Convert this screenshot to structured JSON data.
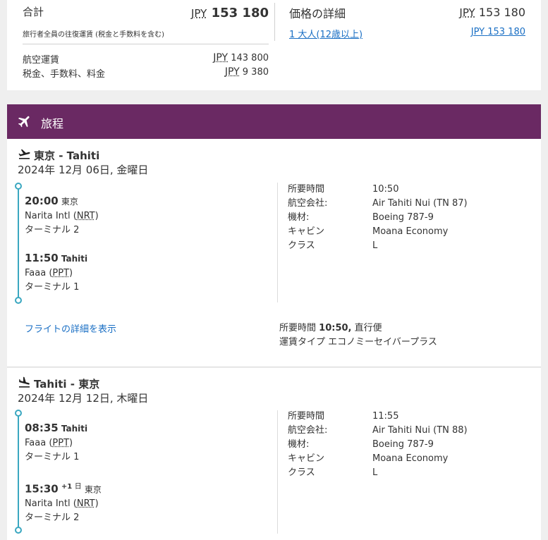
{
  "price_summary": {
    "total_label": "合計",
    "currency": "JPY",
    "total_amount": "153 180",
    "total_note": "旅行者全員の往復運賃 (税金と手数料を含む)",
    "fare_label": "航空運賃",
    "fare_amount": "143 800",
    "tax_label": "税金、手数料、料金",
    "tax_amount": "9 380"
  },
  "price_detail": {
    "title": "価格の詳細",
    "total_amount": "153 180",
    "passenger_link": "1 大人(12歳以上)",
    "passenger_amount": "153 180"
  },
  "itinerary": {
    "title": "旅程",
    "accent_color": "#6a2963",
    "timeline_color": "#3aa7c0",
    "link_color": "#1a6fc4"
  },
  "segments": [
    {
      "icon": "plane-departure-icon",
      "route": "東京 - Tahiti",
      "date": "2024年 12月 06日, 金曜日",
      "departure": {
        "time": "20:00",
        "day_offset": "",
        "day_unit": "",
        "city": "東京",
        "airport": "Narita Intl",
        "code": "NRT",
        "terminal": "ターミナル 2"
      },
      "arrival": {
        "time": "11:50",
        "day_offset": "",
        "day_unit": "",
        "city": "Tahiti",
        "airport": "Faaa",
        "code": "PPT",
        "terminal": "ターミナル 1"
      },
      "details": [
        {
          "label": "所要時間",
          "value": "10:50"
        },
        {
          "label": "航空会社:",
          "value": "Air Tahiti Nui (TN 87)"
        },
        {
          "label": "機材:",
          "value": "Boeing 787-9"
        },
        {
          "label": "キャビン",
          "value": "Moana Economy"
        },
        {
          "label": "クラス",
          "value": "L"
        }
      ],
      "details_link": "フライトの詳細を表示",
      "summary_duration_label": "所要時間",
      "summary_duration": "10:50,",
      "summary_direct": "直行便",
      "summary_fare": "運賃タイプ エコノミーセイバープラス"
    },
    {
      "icon": "plane-arrival-icon",
      "route": "Tahiti - 東京",
      "date": "2024年 12月 12日, 木曜日",
      "departure": {
        "time": "08:35",
        "day_offset": "",
        "day_unit": "",
        "city": "Tahiti",
        "airport": "Faaa",
        "code": "PPT",
        "terminal": "ターミナル 1"
      },
      "arrival": {
        "time": "15:30",
        "day_offset": "+1",
        "day_unit": "日",
        "city": "東京",
        "airport": "Narita Intl",
        "code": "NRT",
        "terminal": "ターミナル 2"
      },
      "details": [
        {
          "label": "所要時間",
          "value": "11:55"
        },
        {
          "label": "航空会社:",
          "value": "Air Tahiti Nui (TN 88)"
        },
        {
          "label": "機材:",
          "value": "Boeing 787-9"
        },
        {
          "label": "キャビン",
          "value": "Moana Economy"
        },
        {
          "label": "クラス",
          "value": "L"
        }
      ]
    }
  ]
}
